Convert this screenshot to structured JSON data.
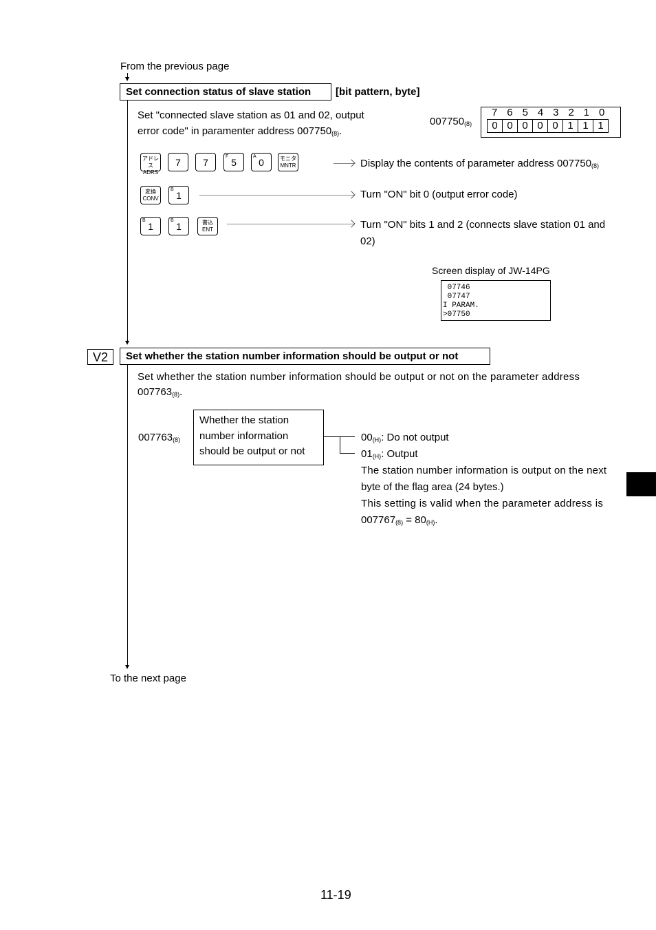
{
  "from_previous": "From the previous page",
  "to_next": "To the next page",
  "section1": {
    "title": "Set connection status of slave station",
    "tag": "[bit pattern, byte]",
    "desc_line1": "Set \"connected slave station as 01 and 02, output",
    "desc_line2": "error code\" in paramenter address 007750",
    "desc_sub": "(8)",
    "desc_end": ".",
    "address": "007750",
    "address_sub": "(8)",
    "bit_headers": [
      "7",
      "6",
      "5",
      "4",
      "3",
      "2",
      "1",
      "0"
    ],
    "bit_values": [
      "0",
      "0",
      "0",
      "0",
      "0",
      "1",
      "1",
      "1"
    ],
    "steps": [
      {
        "keys": [
          {
            "jp": "アドレス",
            "en": "ADRS"
          },
          {
            "label": "7"
          },
          {
            "label": "7"
          },
          {
            "sup": "F",
            "label": "5"
          },
          {
            "sup": "A",
            "label": "0"
          },
          {
            "jp": "モニタ",
            "en": "MNTR"
          }
        ],
        "text": "Display the contents of parameter address 007750",
        "text_sub": "(8)"
      },
      {
        "keys": [
          {
            "jp": "変換",
            "en": "CONV"
          },
          {
            "sup": "B",
            "label": "1"
          }
        ],
        "text": "Turn \"ON\" bit 0 (output error code)"
      },
      {
        "keys": [
          {
            "sup": "B",
            "label": "1"
          },
          {
            "sup": "B",
            "label": "1"
          },
          {
            "jp": "書込",
            "en": "ENT"
          }
        ],
        "text": "Turn \"ON\" bits 1 and 2 (connects slave station 01 and",
        "text2": "02)"
      }
    ],
    "screen_caption": "Screen display of JW-14PG",
    "screen_lines": [
      " 07746",
      " 07747",
      "I PARAM.",
      ">07750"
    ]
  },
  "section2": {
    "marker": "V2",
    "title": "Set whether the station number information should be output or not",
    "desc_line1": "Set whether the station number information should be output or not on the parameter address",
    "desc_line2": "007763",
    "desc_sub": "(8)",
    "desc_end": ".",
    "address": "007763",
    "address_sub": "(8)",
    "box_lines": [
      "Whether the station",
      "number information",
      "should be output or not"
    ],
    "options": [
      {
        "value": "00",
        "sub": "(H)",
        "label": ": Do not output"
      },
      {
        "value": "01",
        "sub": "(H)",
        "label": ": Output"
      }
    ],
    "note_lines": [
      "The station number information is output on the next",
      "byte of the flag area (24 bytes.)",
      "This setting is valid when the parameter address is"
    ],
    "note_last": {
      "a": "007767",
      "a_sub": "(8)",
      "eq": " = 80",
      "b_sub": "(H)",
      "end": "."
    }
  },
  "page_number": "11-19"
}
